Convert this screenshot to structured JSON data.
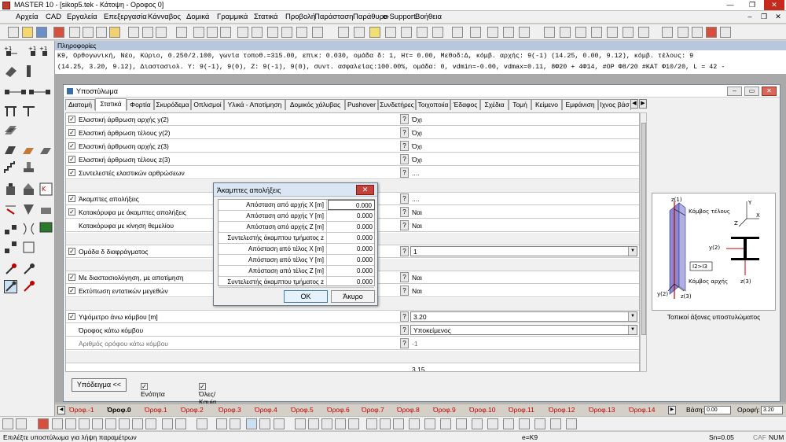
{
  "window": {
    "title": "MASTER 10 - [sikop5.tek - Κάτοψη - Οροφος 0]"
  },
  "menu": [
    "Αρχεία",
    "CAD",
    "Εργαλεία",
    "Επεξεργασία",
    "Κάνναβος",
    "Δομικά",
    "Γραμμικά",
    "Στατικά",
    "Προβολή",
    "Παράσταση",
    "Παράθυρα",
    "e-Support",
    "Βοήθεια"
  ],
  "properties": {
    "header": "Πληροφορίες",
    "line1": "Κ9, Ορθογωνική, Νέο, Κύριο, 0.250/2.100, γωνία τοποθ.=315.00,  επικ: 0.030, ομάδα δ: 1, Ητ= 0.00, Μεθοδ:Δ,  κόμβ. αρχής: 9(-1) (14.25, 0.00, 9.12),  κόμβ. τέλους: 9",
    "line2": "(14.25, 3.20, 9.12), Διαστασιολ. Υ: 9(-1), 9(0), Ζ: 9(-1), 9(0), συντ. ασφαλείας:100.00%,  ομάδα: 0, vdmin=-0.00, vdmax=0.11,  8Φ20 + 4Φ14,  #ΟΡ Φ8/20 #ΚΑΤ Φ10/20,  L = 42 -"
  },
  "mdi": {
    "title": "Υποστύλωμα",
    "tabs": [
      "Διατομή",
      "Στατικά",
      "Φορτία",
      "Σκυρόδεμα",
      "Οπλισμοί",
      "Υλικά - Αποτίμηση",
      "Δομικός χάλυβας",
      "Pushover",
      "Συνδετήρες",
      "Τοιχοποιία",
      "Έδαφος",
      "Σχέδια",
      "Τομή",
      "Κείμενο",
      "Εμφάνιση",
      "Ιχνος βάσ"
    ],
    "active_tab": "Στατικά",
    "rows": [
      {
        "label": "Ελαστική άρθρωση αρχής y(2)",
        "value": "Όχι",
        "checked": true
      },
      {
        "label": "Ελαστική άρθρωση τέλους y(2)",
        "value": "Όχι",
        "checked": true
      },
      {
        "label": "Ελαστική άρθρωση αρχής z(3)",
        "value": "Όχι",
        "checked": true
      },
      {
        "label": "Ελαστική άρθρωση τέλους z(3)",
        "value": "Όχι",
        "checked": true
      },
      {
        "label": "Συντελεστές ελαστικών αρθρώσεων",
        "value": "....",
        "checked": true
      },
      {
        "label": "Άκαμπτες απολήξεις",
        "value": "....",
        "checked": true
      },
      {
        "label": "Κατακόρυφα με άκαμπτες απολήξεις",
        "value": "Ναι",
        "checked": true
      },
      {
        "label": "Κατακόρυφα με κίνηση θεμελίου",
        "value": "Ναι",
        "checked": false
      },
      {
        "label": "Ομάδα δ διαφράγματος",
        "value": "1",
        "checked": true
      },
      {
        "label": "Με διαστασιολόγηση, με αποτίμηση",
        "value": "Ναι",
        "checked": true
      },
      {
        "label": "Εκτύπωση εντατικών μεγεθών",
        "value": "Ναι",
        "checked": true
      },
      {
        "label": "Υψόμετρο άνω κόμβου [m]",
        "value": "3.20",
        "checked": true
      },
      {
        "label": "Όροφος κάτω κόμβου",
        "value": "Υποκείμενος",
        "checked": false
      },
      {
        "label": "Αριθμός ορόφου κάτω κόμβου",
        "value": "-1",
        "checked": false
      }
    ],
    "partial_value": "3.15",
    "example_button": "Υπόδειγμα <<",
    "unity_label": "Ενότητα",
    "all_none_label": "Όλες/Καμία",
    "axes_caption": "Τοπικοί άξονες υποστυλώματος",
    "axes": {
      "z1": "z(1)",
      "end_node": "Κόμβος τέλους",
      "y": "Y",
      "x": "X",
      "z": "Z",
      "y2": "y(2)",
      "eq": "I2>I3",
      "start_node": "Κόμβος αρχής",
      "z3a": "z(3)",
      "y2b": "y(2)",
      "z3b": "z(3)"
    }
  },
  "dialog": {
    "title": "Άκαμπτες απολήξεις",
    "rows": [
      {
        "label": "Απόσταση από αρχής X [m]",
        "value": "0.000"
      },
      {
        "label": "Απόσταση από αρχής Y [m]",
        "value": "0.000"
      },
      {
        "label": "Απόσταση από αρχής Z [m]",
        "value": "0.000"
      },
      {
        "label": "Συντελεστής άκαμπτου τμήματος z",
        "value": "0.000"
      },
      {
        "label": "Απόσταση από τέλος X [m]",
        "value": "0.000"
      },
      {
        "label": "Απόσταση από τέλος Y [m]",
        "value": "0.000"
      },
      {
        "label": "Απόσταση από τέλος Z [m]",
        "value": "0.000"
      },
      {
        "label": "Συντελεστής άκαμπτου τμήματος z",
        "value": "0.000"
      }
    ],
    "ok": "OK",
    "cancel": "Άκυρο"
  },
  "floors": {
    "tabs": [
      "Όροφ.-1",
      "Όροφ.0",
      "Όροφ.1",
      "Όροφ.2",
      "Όροφ.3",
      "Όροφ.4",
      "Όροφ.5",
      "Όροφ.6",
      "Όροφ.7",
      "Όροφ.8",
      "Όροφ.9",
      "Όροφ.10",
      "Όροφ.11",
      "Όροφ.12",
      "Όροφ.13",
      "Όροφ.14"
    ],
    "active": "Όροφ.0",
    "base_label": "Βάση:",
    "base_value": "0.00",
    "floor_label": "Οροφή:",
    "floor_value": "3.20"
  },
  "status": {
    "hint": "Επιλέξτε υποστύλωμα για λήψη παραμέτρων",
    "element": "e=K9",
    "snap": "Sn=0.05",
    "caf": "CAF",
    "num": "NUM"
  }
}
